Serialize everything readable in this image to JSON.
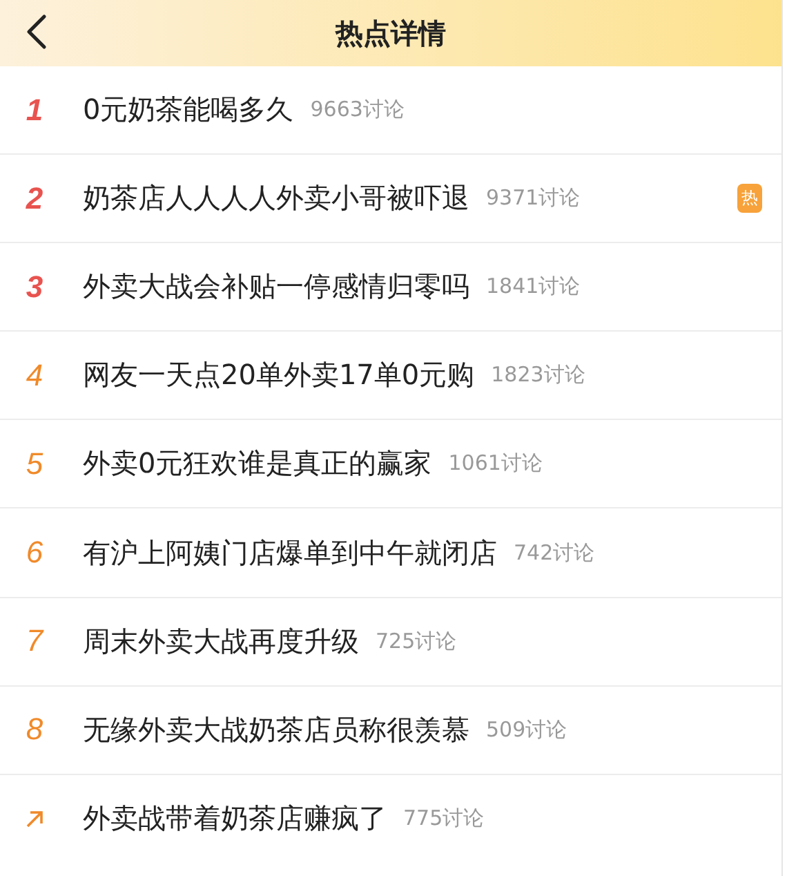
{
  "header": {
    "title": "热点详情"
  },
  "items": [
    {
      "kind": "top",
      "rank": "1",
      "color": "#e8534f",
      "title": "0元奶茶能喝多久",
      "count": "9663讨论"
    },
    {
      "kind": "top",
      "rank": "2",
      "color": "#e8534f",
      "title": "奶茶店人人人人外卖小哥被吓退",
      "count": "9371讨论",
      "badge": "热"
    },
    {
      "kind": "top",
      "rank": "3",
      "color": "#e8534f",
      "title": "外卖大战会补贴一停感情归零吗",
      "count": "1841讨论"
    },
    {
      "kind": "rank",
      "rank": "4",
      "color": "#f08a2a",
      "title": "网友一天点20单外卖17单0元购",
      "count": "1823讨论"
    },
    {
      "kind": "rank",
      "rank": "5",
      "color": "#f08a2a",
      "title": "外卖0元狂欢谁是真正的赢家",
      "count": "1061讨论"
    },
    {
      "kind": "rank",
      "rank": "6",
      "color": "#f08a2a",
      "title": "有沪上阿姨门店爆单到中午就闭店",
      "count": "742讨论"
    },
    {
      "kind": "rank",
      "rank": "7",
      "color": "#f08a2a",
      "title": "周末外卖大战再度升级",
      "count": "725讨论"
    },
    {
      "kind": "rank",
      "rank": "8",
      "color": "#f08a2a",
      "title": "无缘外卖大战奶茶店员称很羡慕",
      "count": "509讨论"
    },
    {
      "kind": "rising",
      "color": "#f08a2a",
      "title": "外卖战带着奶茶店赚疯了",
      "count": "775讨论"
    }
  ]
}
